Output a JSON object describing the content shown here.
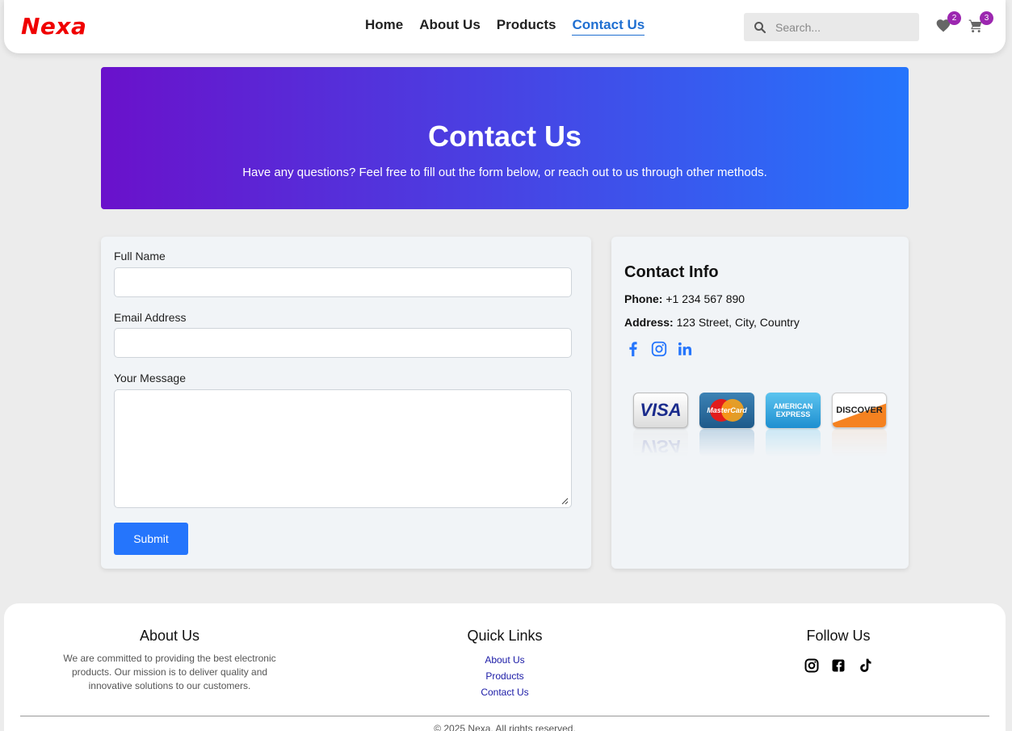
{
  "brand": {
    "logo": "Nexa",
    "logo_color": "#f00000"
  },
  "nav": {
    "links": [
      "Home",
      "About Us",
      "Products",
      "Contact Us"
    ],
    "active": "Contact Us"
  },
  "search": {
    "placeholder": "Search..."
  },
  "header_icons": {
    "wishlist": {
      "icon": "heart-icon",
      "count": "2"
    },
    "cart": {
      "icon": "cart-icon",
      "count": "3"
    }
  },
  "hero": {
    "title": "Contact Us",
    "subtitle": "Have any questions? Feel free to fill out the form below, or reach out to us through other methods.",
    "gradient": [
      "#6a11cb",
      "#2575fc"
    ]
  },
  "form": {
    "full_name_label": "Full Name",
    "full_name_value": "",
    "email_label": "Email Address",
    "email_value": "",
    "message_label": "Your Message",
    "message_value": "",
    "submit_label": "Submit",
    "accent": "#2575fc"
  },
  "contact_info": {
    "title": "Contact Info",
    "phone_label": "Phone:",
    "phone_value": "+1 234 567 890",
    "address_label": "Address:",
    "address_value": "123 Street, City, Country",
    "social_icons": [
      "facebook-icon",
      "instagram-icon",
      "linkedin-icon"
    ],
    "payment_cards": [
      "VISA",
      "MasterCard",
      "AMERICAN EXPRESS",
      "DISCOVER"
    ]
  },
  "footer": {
    "about_title": "About Us",
    "about_text": "We are committed to providing the best electronic products. Our mission is to deliver quality and innovative solutions to our customers.",
    "links_title": "Quick Links",
    "links": [
      "About Us",
      "Products",
      "Contact Us"
    ],
    "follow_title": "Follow Us",
    "follow_icons": [
      "instagram-icon",
      "facebook-icon",
      "tiktok-icon"
    ],
    "copyright": "© 2025 Nexa. All rights reserved."
  }
}
